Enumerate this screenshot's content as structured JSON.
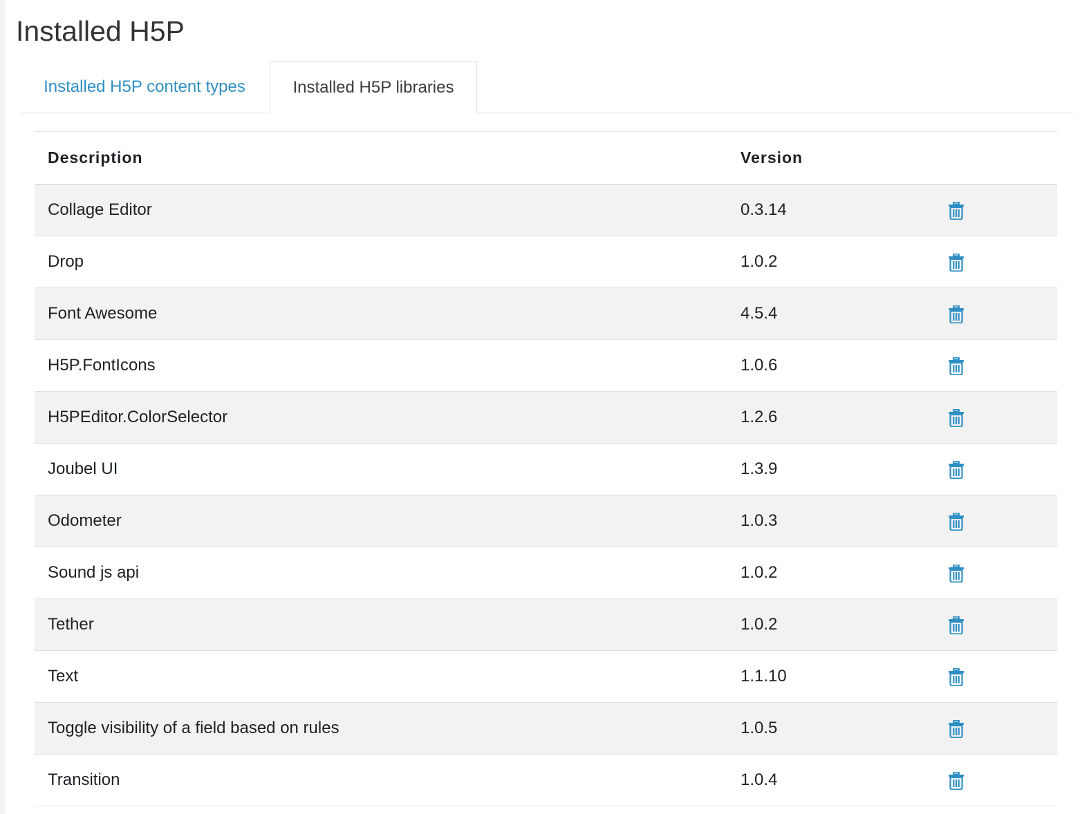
{
  "page": {
    "title": "Installed H5P"
  },
  "tabs": [
    {
      "label": "Installed H5P content types",
      "active": false
    },
    {
      "label": "Installed H5P libraries",
      "active": true
    }
  ],
  "table": {
    "headers": {
      "description": "Description",
      "version": "Version",
      "actions": ""
    },
    "rows": [
      {
        "description": "Collage Editor",
        "version": "0.3.14",
        "action_icon": "trash-icon"
      },
      {
        "description": "Drop",
        "version": "1.0.2",
        "action_icon": "trash-icon"
      },
      {
        "description": "Font Awesome",
        "version": "4.5.4",
        "action_icon": "trash-icon"
      },
      {
        "description": "H5P.FontIcons",
        "version": "1.0.6",
        "action_icon": "trash-icon"
      },
      {
        "description": "H5PEditor.ColorSelector",
        "version": "1.2.6",
        "action_icon": "trash-icon"
      },
      {
        "description": "Joubel UI",
        "version": "1.3.9",
        "action_icon": "trash-icon"
      },
      {
        "description": "Odometer",
        "version": "1.0.3",
        "action_icon": "trash-icon"
      },
      {
        "description": "Sound js api",
        "version": "1.0.2",
        "action_icon": "trash-icon"
      },
      {
        "description": "Tether",
        "version": "1.0.2",
        "action_icon": "trash-icon"
      },
      {
        "description": "Text",
        "version": "1.1.10",
        "action_icon": "trash-icon"
      },
      {
        "description": "Toggle visibility of a field based on rules",
        "version": "1.0.5",
        "action_icon": "trash-icon"
      },
      {
        "description": "Transition",
        "version": "1.0.4",
        "action_icon": "trash-icon"
      }
    ]
  },
  "colors": {
    "link": "#2f8fc4",
    "icon": "#2f8fc4",
    "stripe": "#f2f2f2",
    "border": "#dee2e6"
  }
}
